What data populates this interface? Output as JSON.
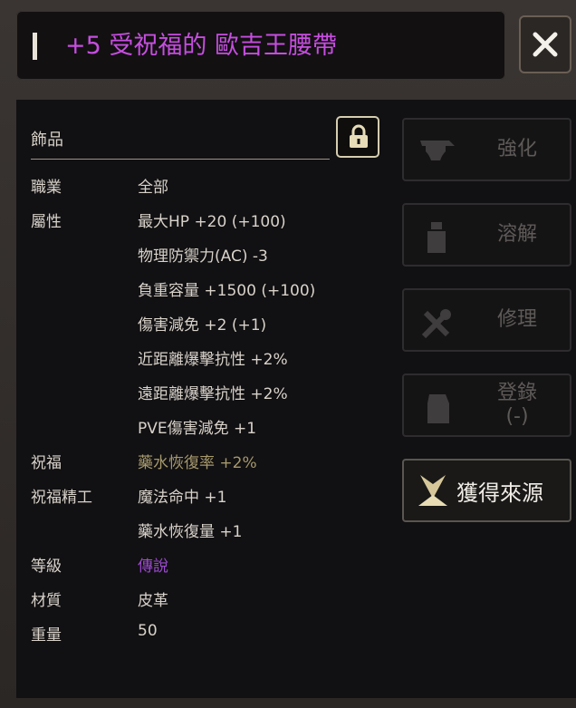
{
  "window": {
    "title": "+5 受祝福的 歐吉王腰帶",
    "title_color": "#c64ee0",
    "close_icon": "close-icon"
  },
  "item": {
    "category": "飾品",
    "lock_icon": "lock-icon",
    "rows": [
      {
        "label": "職業",
        "value": "全部",
        "tone": "normal"
      },
      {
        "label": "屬性",
        "value": "最大HP +20 (+100)",
        "tone": "normal"
      },
      {
        "label": "",
        "value": "物理防禦力(AC) -3",
        "tone": "normal"
      },
      {
        "label": "",
        "value": "負重容量 +1500 (+100)",
        "tone": "normal"
      },
      {
        "label": "",
        "value": "傷害減免 +2 (+1)",
        "tone": "normal"
      },
      {
        "label": "",
        "value": "近距離爆擊抗性 +2%",
        "tone": "normal"
      },
      {
        "label": "",
        "value": "遠距離爆擊抗性 +2%",
        "tone": "normal"
      },
      {
        "label": "",
        "value": "PVE傷害減免 +1",
        "tone": "normal"
      },
      {
        "label": "祝福",
        "value": "藥水恢復率 +2%",
        "tone": "gold"
      },
      {
        "label": "祝福精工",
        "value": "魔法命中 +1",
        "tone": "normal"
      },
      {
        "label": "",
        "value": "藥水恢復量 +1",
        "tone": "normal"
      },
      {
        "label": "等級",
        "value": "傳說",
        "tone": "purple"
      },
      {
        "label": "材質",
        "value": "皮革",
        "tone": "normal"
      },
      {
        "label": "重量",
        "value": "50",
        "tone": "normal"
      }
    ]
  },
  "actions": {
    "enhance": {
      "label": "強化",
      "icon": "anvil-icon",
      "enabled": false
    },
    "dissolve": {
      "label": "溶解",
      "icon": "flask-icon",
      "enabled": false
    },
    "repair": {
      "label": "修理",
      "icon": "tools-icon",
      "enabled": false
    },
    "register": {
      "label": "登錄",
      "sub": "(-)",
      "icon": "register-icon",
      "enabled": false
    },
    "source": {
      "label": "獲得來源",
      "icon": "compass-icon",
      "enabled": true
    }
  }
}
